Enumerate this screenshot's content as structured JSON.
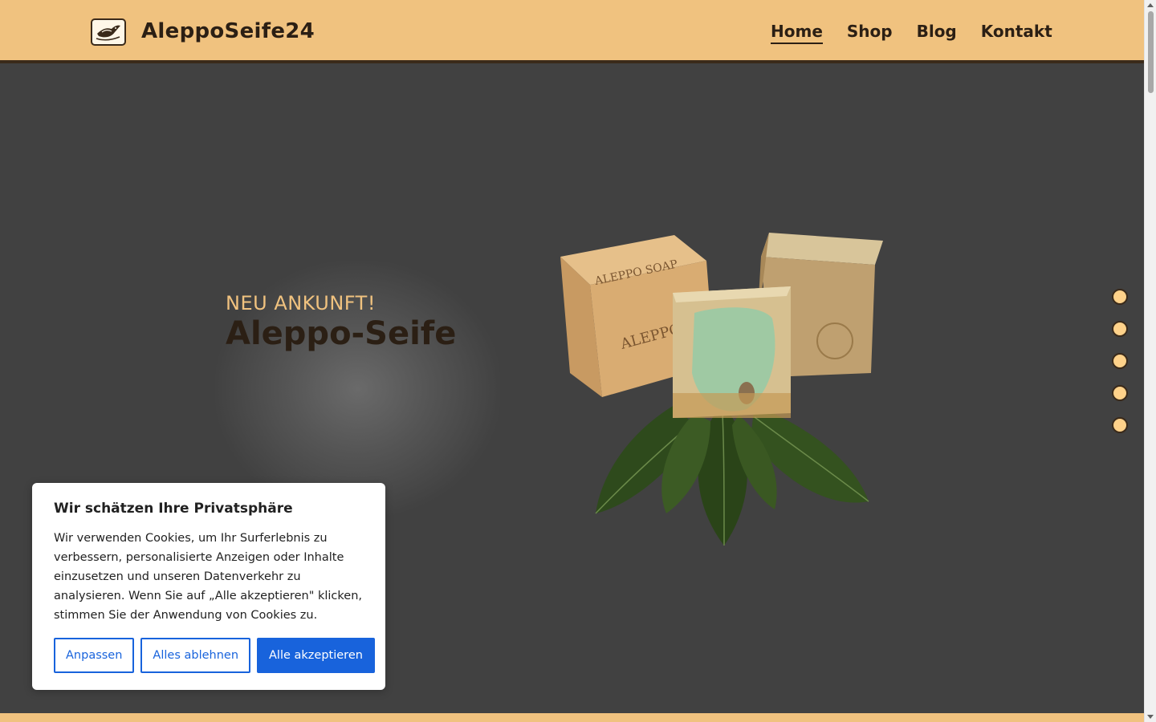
{
  "header": {
    "brand": "AleppoSeife24",
    "logo_icon": "dove-icon",
    "nav": [
      {
        "label": "Home",
        "active": true
      },
      {
        "label": "Shop",
        "active": false
      },
      {
        "label": "Blog",
        "active": false
      },
      {
        "label": "Kontakt",
        "active": false
      }
    ]
  },
  "hero": {
    "kicker": "NEU ANKUNFT!",
    "title": "Aleppo-Seife",
    "image": "aleppo-soap-bars-with-laurel-leaves",
    "slider_dots": 5
  },
  "cookie_banner": {
    "title": "Wir schätzen Ihre Privatsphäre",
    "text": "Wir verwenden Cookies, um Ihr Surferlebnis zu verbessern, personalisierte Anzeigen oder Inhalte einzusetzen und unseren Datenverkehr zu analysieren. Wenn Sie auf „Alle akzeptieren\" klicken, stimmen Sie der Anwendung von Cookies zu.",
    "customize": "Anpassen",
    "reject": "Alles ablehnen",
    "accept": "Alle akzeptieren"
  },
  "colors": {
    "header_bg": "#f0c27f",
    "hero_bg": "#414141",
    "accent": "#f0c27f",
    "dark_text": "#2b1f14",
    "button_blue": "#1863dc"
  }
}
